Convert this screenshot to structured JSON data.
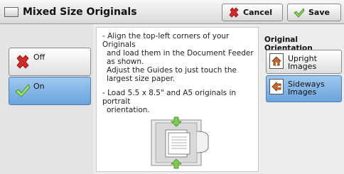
{
  "header": {
    "title": "Mixed Size Originals",
    "cancel_label": "Cancel",
    "save_label": "Save"
  },
  "options": {
    "off_label": "Off",
    "on_label": "On",
    "selected": "On"
  },
  "instructions": {
    "line1": "- Align the top-left corners of your Originals",
    "line2": "and load them in the Document Feeder",
    "line3": "as shown.",
    "line4": "Adjust the Guides to just touch the",
    "line5": "largest size paper.",
    "line6": "- Load 5.5 x 8.5\" and A5 originals in portrait",
    "line7": "orientation."
  },
  "orientation": {
    "title": "Original Orientation",
    "upright_label": "Upright Images",
    "sideways_label_1": "Sideways",
    "sideways_label_2": "Images",
    "selected": "Sideways Images"
  },
  "colors": {
    "selected_blue": "#7fb2e5",
    "cancel_icon": "#d32a2a",
    "save_icon": "#6cc24a"
  },
  "icons": {
    "title": "document-icon",
    "cancel": "red-x-icon",
    "save": "green-check-icon",
    "off": "red-x-icon",
    "on": "green-check-icon",
    "upright": "upright-image-icon",
    "sideways": "sideways-image-icon"
  }
}
